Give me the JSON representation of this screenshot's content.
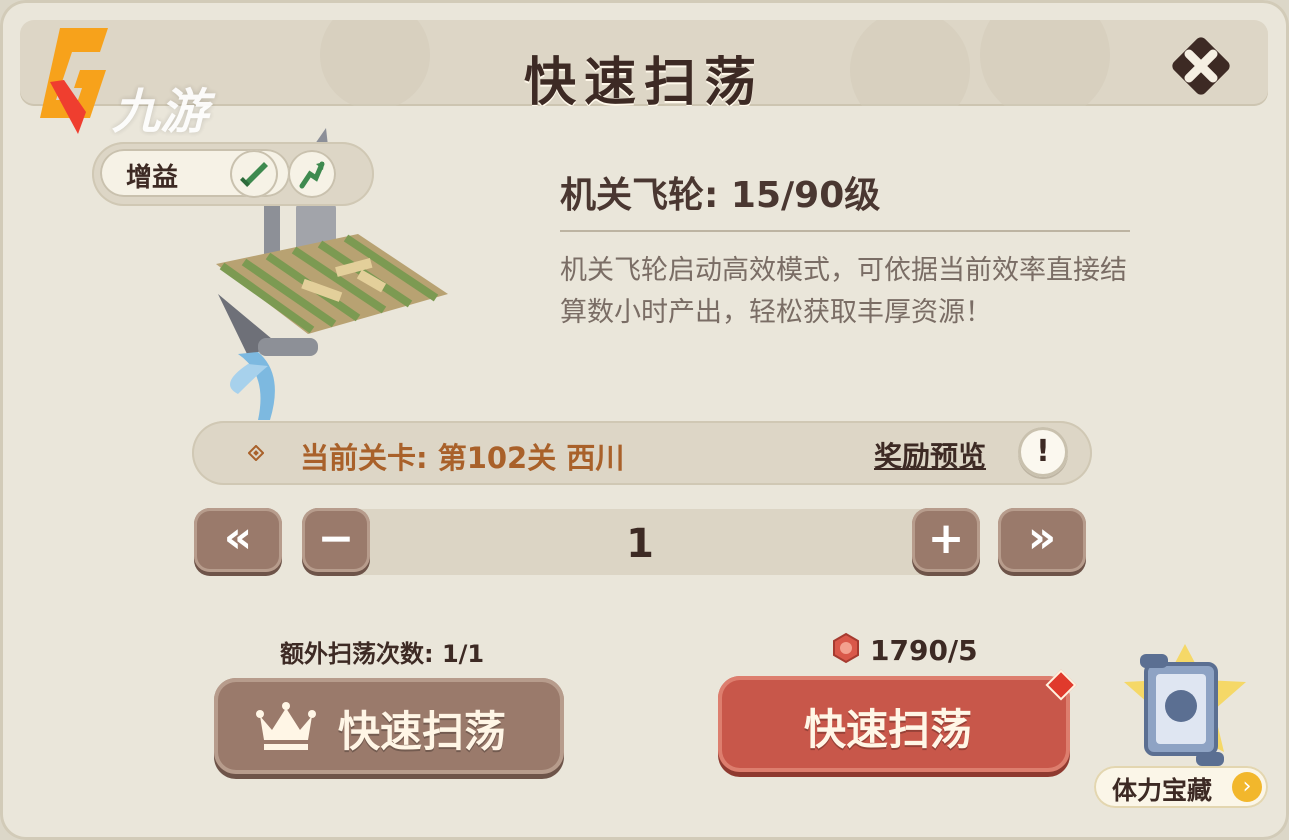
{
  "header": {
    "title": "快速扫荡"
  },
  "watermark": {
    "text": "九游"
  },
  "buff": {
    "label": "增益",
    "icons": [
      "sword-icon",
      "arrow-up-icon"
    ]
  },
  "building": {
    "title": "机关飞轮: 15/90级",
    "description": "机关飞轮启动高效模式，可依据当前效率直接结算数小时产出，轻松获取丰厚资源！"
  },
  "stage": {
    "text": "当前关卡: 第102关 西川",
    "reward_preview": "奖励预览",
    "info": "!"
  },
  "stepper": {
    "min": "«",
    "minus": "−",
    "value": "1",
    "plus": "+",
    "max": "»"
  },
  "extra_sweeps": {
    "label": "额外扫荡次数: 1/1"
  },
  "cost": {
    "value": "1790/5"
  },
  "buttons": {
    "vip_sweep": "快速扫荡",
    "sweep": "快速扫荡"
  },
  "treasure": {
    "label": "体力宝藏",
    "arrow": "›"
  },
  "colors": {
    "panel_bg": "#eae6da",
    "header_bg": "#ddd6c6",
    "title_text": "#3d2a24",
    "stage_text": "#a9612a",
    "brown_button": "#9a7a6b",
    "red_button": "#c8574a"
  }
}
